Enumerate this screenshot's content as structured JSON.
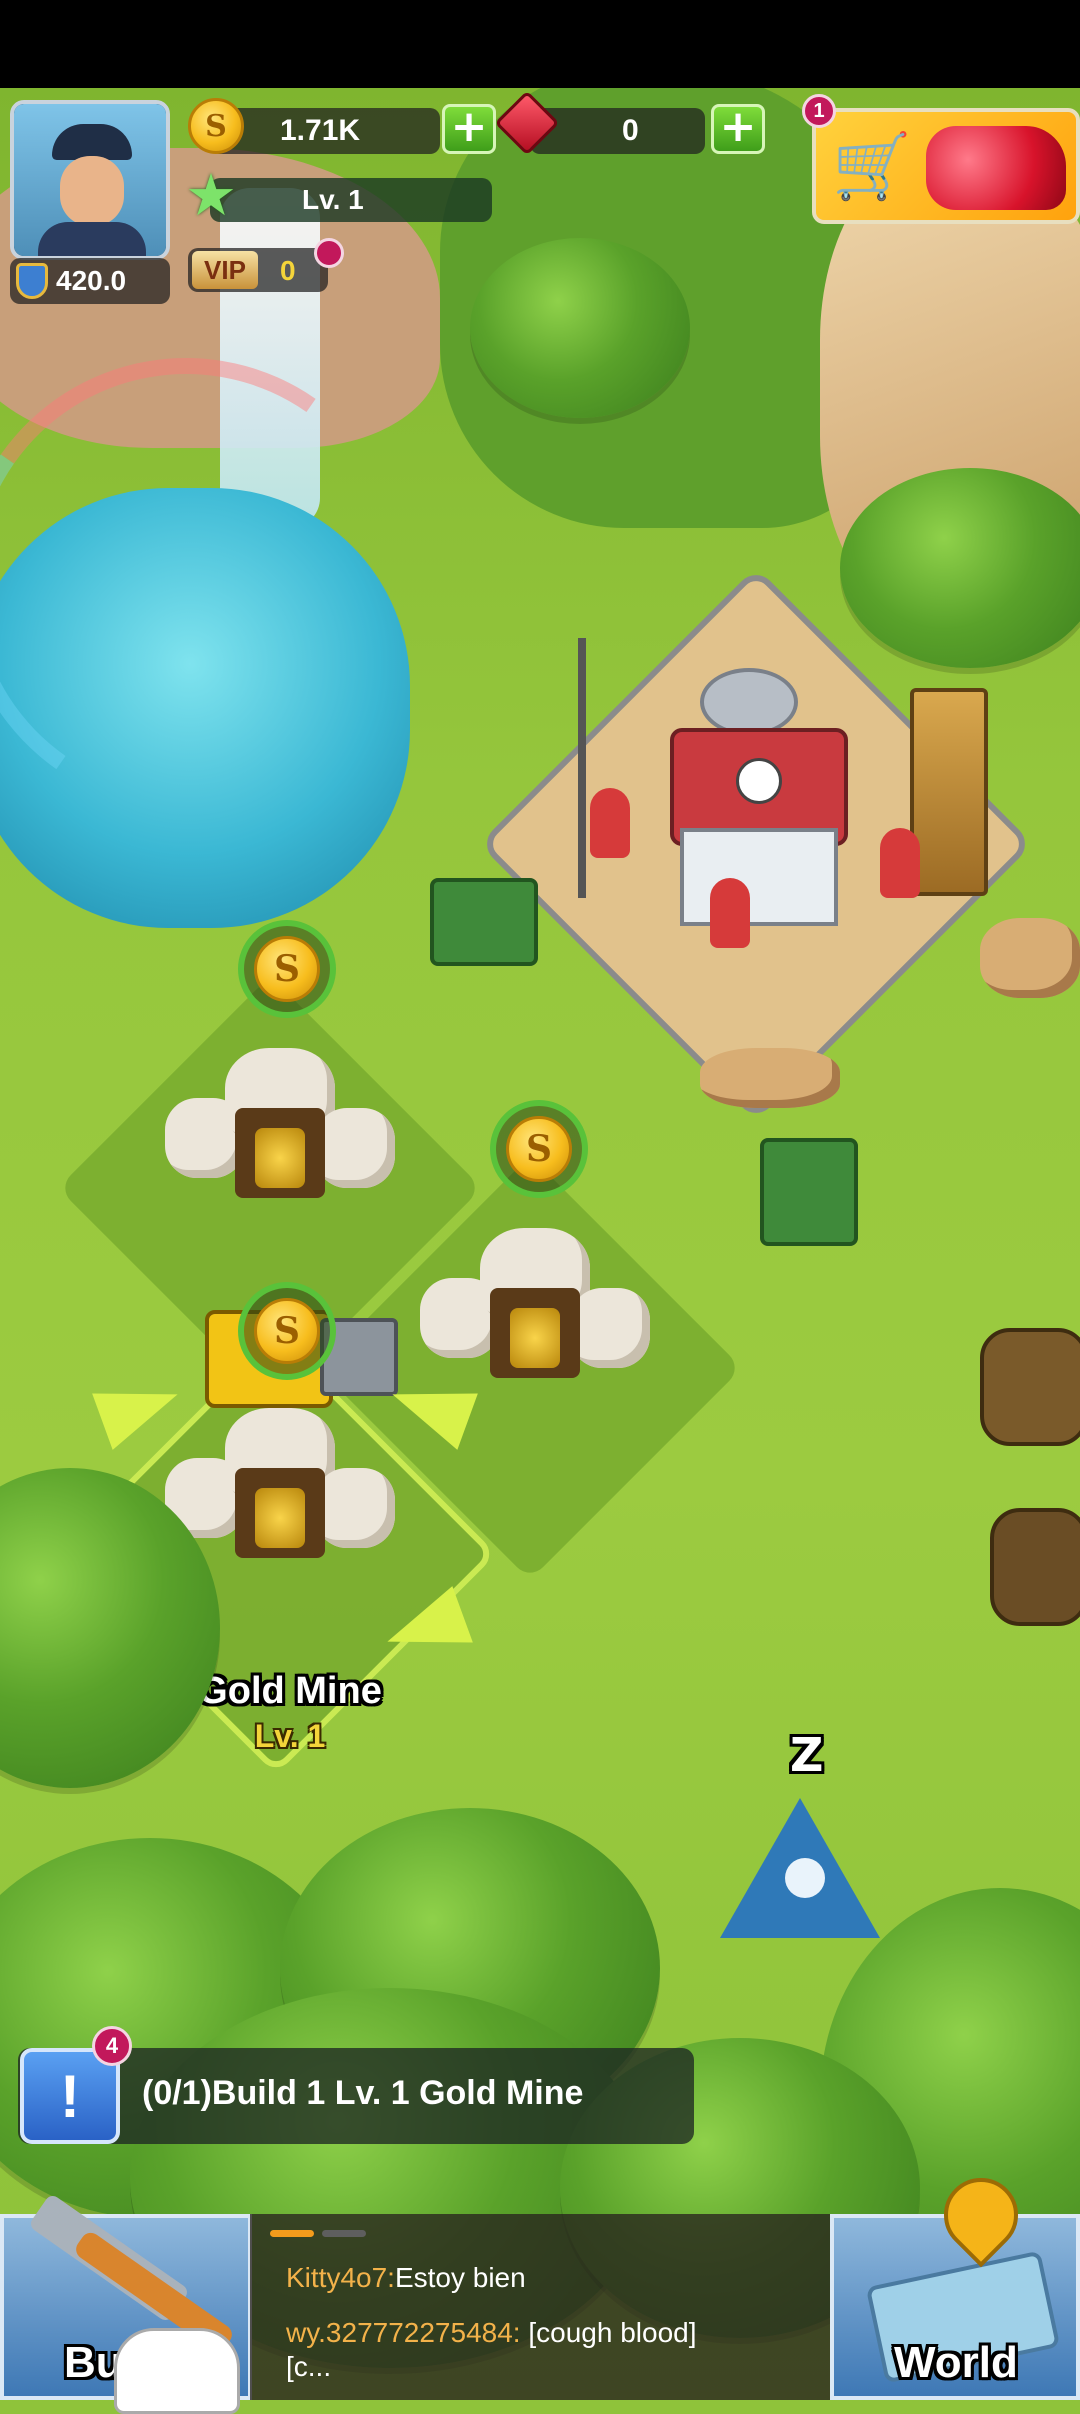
{
  "hud": {
    "power": "420.0",
    "gold": "1.71K",
    "gems": "0",
    "level": "Lv. 1",
    "vip_label": "VIP",
    "vip_level": "0",
    "shop_badge": "1"
  },
  "map": {
    "selected_building_name": "Gold Mine",
    "selected_building_level": "Lv. 1",
    "sleep_glyph": "Z",
    "coin_glyph": "S"
  },
  "quest": {
    "badge": "4",
    "icon_glyph": "!",
    "text": "(0/1)Build 1 Lv. 1 Gold Mine"
  },
  "chat": {
    "messages": [
      {
        "user": "Kitty4o7:",
        "text": "Estoy bien"
      },
      {
        "user": "wy.327772275484:",
        "text": "[cough blood][c..."
      }
    ]
  },
  "buttons": {
    "build_label": "Bu",
    "world_label": "World"
  },
  "colors": {
    "grass": "#95c63c",
    "gold": "#f7bd1d",
    "gem": "#e2182b",
    "plus_green": "#4caf1f",
    "chat_user": "#f3b24a"
  }
}
